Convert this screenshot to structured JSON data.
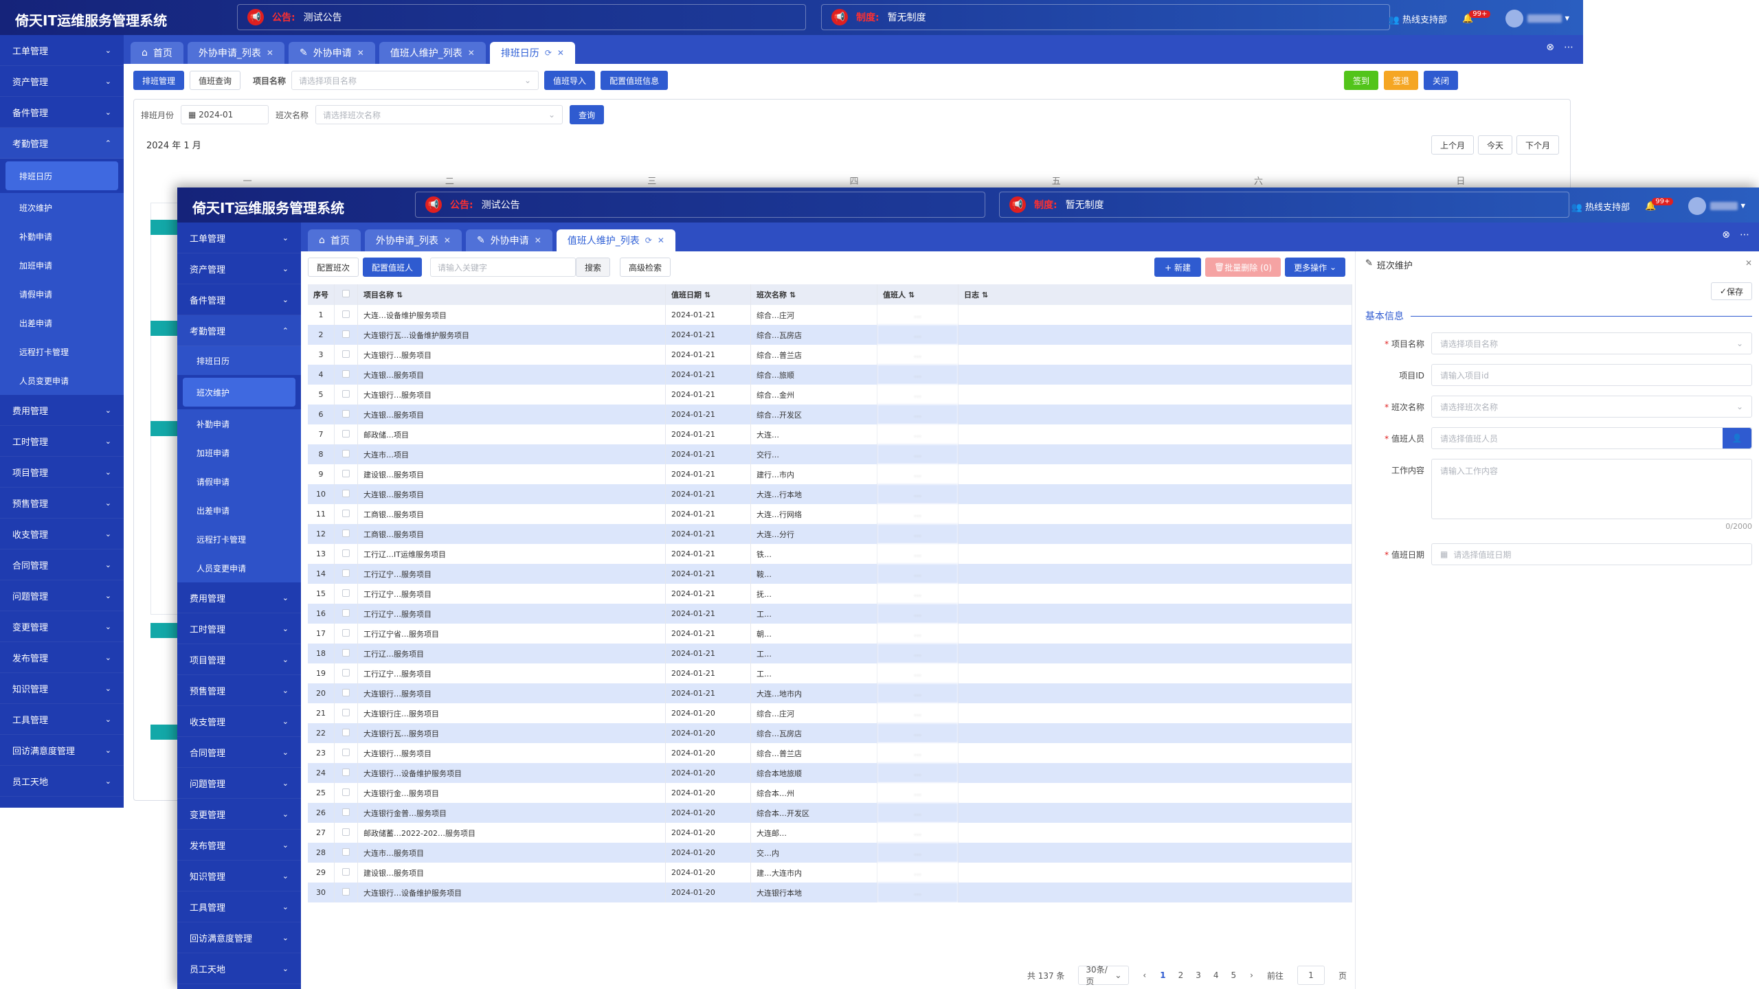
{
  "app": {
    "title": "倚天IT运维服务管理系统",
    "notice_label": "公告:",
    "notice_text": "测试公告",
    "policy_label": "制度:",
    "policy_text": "暂无制度",
    "hotline": "热线支持部",
    "badge": "99+",
    "colors": {
      "primary": "#2f5bd0",
      "sidebar": "#1f3cb0",
      "green": "#52c41a",
      "orange": "#f5a623",
      "teal": "#13a8a8",
      "danger": "#f5a3a3"
    }
  },
  "sidebar": {
    "groups": [
      "工单管理",
      "资产管理",
      "备件管理",
      "考勤管理",
      "费用管理",
      "工时管理",
      "项目管理",
      "预售管理",
      "收支管理",
      "合同管理",
      "问题管理",
      "变更管理",
      "发布管理",
      "知识管理",
      "工具管理",
      "回访满意度管理",
      "员工天地"
    ],
    "attendance_sub": [
      "排班日历",
      "班次维护",
      "补勤申请",
      "加班申请",
      "请假申请",
      "出差申请",
      "远程打卡管理",
      "人员变更申请"
    ]
  },
  "back": {
    "tabs": [
      "首页",
      "外协申请_列表",
      "外协申请",
      "值班人维护_列表",
      "排班日历"
    ],
    "toolbar": {
      "schedule_mgmt": "排班管理",
      "duty_query": "值班查询",
      "project_label": "项目名称",
      "project_placeholder": "请选择项目名称",
      "duty_import": "值班导入",
      "config_duty": "配置值班信息",
      "sign_in": "签到",
      "sign_out": "签退",
      "close": "关闭"
    },
    "filter": {
      "month_label": "排班月份",
      "month_value": "2024-01",
      "shift_label": "班次名称",
      "shift_placeholder": "请选择班次名称",
      "query": "查询"
    },
    "calendar": {
      "title": "2024 年 1 月",
      "prev": "上个月",
      "today": "今天",
      "next": "下个月",
      "weekdays": [
        "一",
        "二",
        "三",
        "四",
        "五",
        "六",
        "日"
      ]
    }
  },
  "front": {
    "tabs": [
      "首页",
      "外协申请_列表",
      "外协申请",
      "值班人维护_列表"
    ],
    "toolbar": {
      "config_shift": "配置班次",
      "config_duty_person": "配置值班人",
      "keyword_placeholder": "请输入关键字",
      "search": "搜索",
      "advanced": "高级检索",
      "new": "+ 新建",
      "batch_delete": "批量删除 (0)",
      "more": "更多操作"
    },
    "table": {
      "headers": [
        "序号",
        "项目名称",
        "值班日期",
        "班次名称",
        "值班人",
        "日志"
      ],
      "rows": [
        {
          "no": "1",
          "proj": "大连…设备维护服务项目",
          "date": "2024-01-21",
          "shift": "综合…庄河",
          "person": "…"
        },
        {
          "no": "2",
          "proj": "大连银行瓦…设备维护服务项目",
          "date": "2024-01-21",
          "shift": "综合…瓦房店",
          "person": "…"
        },
        {
          "no": "3",
          "proj": "大连银行…服务项目",
          "date": "2024-01-21",
          "shift": "综合…普兰店",
          "person": "…"
        },
        {
          "no": "4",
          "proj": "大连银…服务项目",
          "date": "2024-01-21",
          "shift": "综合…旅顺",
          "person": "…"
        },
        {
          "no": "5",
          "proj": "大连银行…服务项目",
          "date": "2024-01-21",
          "shift": "综合…金州",
          "person": "…"
        },
        {
          "no": "6",
          "proj": "大连银…服务项目",
          "date": "2024-01-21",
          "shift": "综合…开发区",
          "person": "…"
        },
        {
          "no": "7",
          "proj": "邮政储…项目",
          "date": "2024-01-21",
          "shift": "大连…",
          "person": "…"
        },
        {
          "no": "8",
          "proj": "大连市…项目",
          "date": "2024-01-21",
          "shift": "交行…",
          "person": "…"
        },
        {
          "no": "9",
          "proj": "建设银…服务项目",
          "date": "2024-01-21",
          "shift": "建行…市内",
          "person": "…"
        },
        {
          "no": "10",
          "proj": "大连银…服务项目",
          "date": "2024-01-21",
          "shift": "大连…行本地",
          "person": "…"
        },
        {
          "no": "11",
          "proj": "工商银…服务项目",
          "date": "2024-01-21",
          "shift": "大连…行网络",
          "person": "…"
        },
        {
          "no": "12",
          "proj": "工商银…服务项目",
          "date": "2024-01-21",
          "shift": "大连…分行",
          "person": "…"
        },
        {
          "no": "13",
          "proj": "工行辽…IT运维服务项目",
          "date": "2024-01-21",
          "shift": "铁…",
          "person": "…"
        },
        {
          "no": "14",
          "proj": "工行辽宁…服务项目",
          "date": "2024-01-21",
          "shift": "鞍…",
          "person": "…"
        },
        {
          "no": "15",
          "proj": "工行辽宁…服务项目",
          "date": "2024-01-21",
          "shift": "抚…",
          "person": "…"
        },
        {
          "no": "16",
          "proj": "工行辽宁…服务项目",
          "date": "2024-01-21",
          "shift": "工…",
          "person": "…"
        },
        {
          "no": "17",
          "proj": "工行辽宁省…服务项目",
          "date": "2024-01-21",
          "shift": "朝…",
          "person": "…"
        },
        {
          "no": "18",
          "proj": "工行辽…服务项目",
          "date": "2024-01-21",
          "shift": "工…",
          "person": "…"
        },
        {
          "no": "19",
          "proj": "工行辽宁…服务项目",
          "date": "2024-01-21",
          "shift": "工…",
          "person": "…"
        },
        {
          "no": "20",
          "proj": "大连银行…服务项目",
          "date": "2024-01-21",
          "shift": "大连…地市内",
          "person": "…"
        },
        {
          "no": "21",
          "proj": "大连银行庄…服务项目",
          "date": "2024-01-20",
          "shift": "综合…庄河",
          "person": "…"
        },
        {
          "no": "22",
          "proj": "大连银行瓦…服务项目",
          "date": "2024-01-20",
          "shift": "综合…瓦房店",
          "person": "…"
        },
        {
          "no": "23",
          "proj": "大连银行…服务项目",
          "date": "2024-01-20",
          "shift": "综合…普兰店",
          "person": "…"
        },
        {
          "no": "24",
          "proj": "大连银行…设备维护服务项目",
          "date": "2024-01-20",
          "shift": "综合本地旅顺",
          "person": "…"
        },
        {
          "no": "25",
          "proj": "大连银行金…服务项目",
          "date": "2024-01-20",
          "shift": "综合本…州",
          "person": "…"
        },
        {
          "no": "26",
          "proj": "大连银行金普…服务项目",
          "date": "2024-01-20",
          "shift": "综合本…开发区",
          "person": "…"
        },
        {
          "no": "27",
          "proj": "邮政储蓄…2022-202…服务项目",
          "date": "2024-01-20",
          "shift": "大连邮…",
          "person": "…"
        },
        {
          "no": "28",
          "proj": "大连市…服务项目",
          "date": "2024-01-20",
          "shift": "交…内",
          "person": "…"
        },
        {
          "no": "29",
          "proj": "建设银…服务项目",
          "date": "2024-01-20",
          "shift": "建…大连市内",
          "person": "…"
        },
        {
          "no": "30",
          "proj": "大连银行…设备维护服务项目",
          "date": "2024-01-20",
          "shift": "大连银行本地",
          "person": "…"
        }
      ]
    },
    "pagination": {
      "total": "共 137 条",
      "page_size": "30条/页",
      "pages": [
        "1",
        "2",
        "3",
        "4",
        "5"
      ],
      "goto": "前往",
      "goto_value": "1",
      "page_unit": "页"
    },
    "form": {
      "title": "班次维护",
      "save": "保存",
      "section": "基本信息",
      "project_name": "项目名称",
      "project_name_ph": "请选择项目名称",
      "project_id": "项目ID",
      "project_id_ph": "请输入项目id",
      "shift_name": "班次名称",
      "shift_name_ph": "请选择班次名称",
      "duty_person": "值班人员",
      "duty_person_ph": "请选择值班人员",
      "work_content": "工作内容",
      "work_content_ph": "请输入工作内容",
      "counter": "0/2000",
      "duty_date": "值班日期",
      "duty_date_ph": "请选择值班日期"
    }
  }
}
